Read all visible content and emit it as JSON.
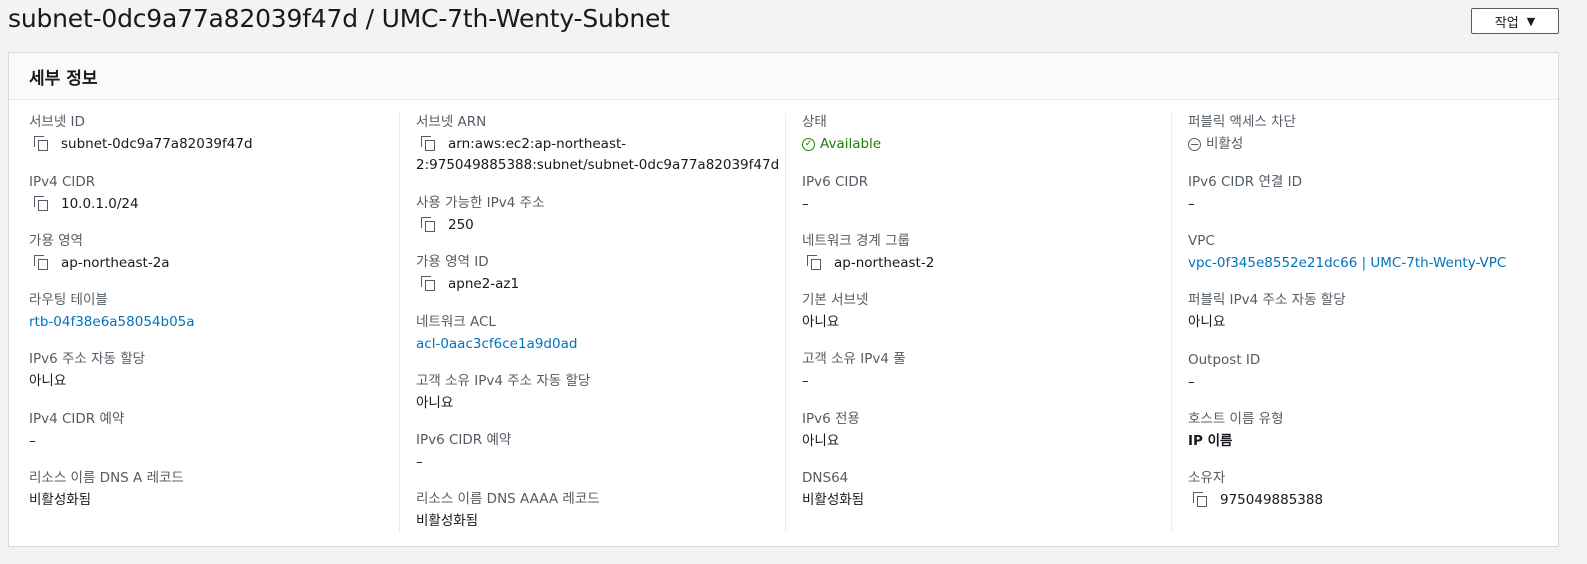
{
  "header": {
    "title": "subnet-0dc9a77a82039f47d / UMC-7th-Wenty-Subnet",
    "actions_label": "작업"
  },
  "panel": {
    "title": "세부 정보"
  },
  "col1": {
    "subnet_id_label": "서브넷 ID",
    "subnet_id_value": "subnet-0dc9a77a82039f47d",
    "ipv4_cidr_label": "IPv4 CIDR",
    "ipv4_cidr_value": "10.0.1.0/24",
    "az_label": "가용 영역",
    "az_value": "ap-northeast-2a",
    "route_table_label": "라우팅 테이블",
    "route_table_value": "rtb-04f38e6a58054b05a",
    "ipv6_auto_label": "IPv6 주소 자동 할당",
    "ipv6_auto_value": "아니요",
    "ipv4_reservation_label": "IPv4 CIDR 예약",
    "ipv4_reservation_value": "–",
    "dns_a_label": "리소스 이름 DNS A 레코드",
    "dns_a_value": "비활성화됨"
  },
  "col2": {
    "arn_label": "서브넷 ARN",
    "arn_value_line1": "arn:aws:ec2:ap-northeast-",
    "arn_value_line2": "2:975049885388:subnet/subnet-0dc9a77a82039f47d",
    "available_ipv4_label": "사용 가능한 IPv4 주소",
    "available_ipv4_value": "250",
    "az_id_label": "가용 영역 ID",
    "az_id_value": "apne2-az1",
    "acl_label": "네트워크 ACL",
    "acl_value": "acl-0aac3cf6ce1a9d0ad",
    "customer_ipv4_auto_label": "고객 소유 IPv4 주소 자동 할당",
    "customer_ipv4_auto_value": "아니요",
    "ipv6_reservation_label": "IPv6 CIDR 예약",
    "ipv6_reservation_value": "–",
    "dns_aaaa_label": "리소스 이름 DNS AAAA 레코드",
    "dns_aaaa_value": "비활성화됨"
  },
  "col3": {
    "state_label": "상태",
    "state_value": "Available",
    "ipv6_cidr_label": "IPv6 CIDR",
    "ipv6_cidr_value": "–",
    "border_group_label": "네트워크 경계 그룹",
    "border_group_value": "ap-northeast-2",
    "default_subnet_label": "기본 서브넷",
    "default_subnet_value": "아니요",
    "customer_pool_label": "고객 소유 IPv4 풀",
    "customer_pool_value": "–",
    "ipv6_only_label": "IPv6 전용",
    "ipv6_only_value": "아니요",
    "dns64_label": "DNS64",
    "dns64_value": "비활성화됨"
  },
  "col4": {
    "public_block_label": "퍼블릭 액세스 차단",
    "public_block_value": "비활성",
    "ipv6_assoc_label": "IPv6 CIDR 연결 ID",
    "ipv6_assoc_value": "–",
    "vpc_label": "VPC",
    "vpc_value": "vpc-0f345e8552e21dc66 | UMC-7th-Wenty-VPC",
    "public_ipv4_auto_label": "퍼블릭 IPv4 주소 자동 할당",
    "public_ipv4_auto_value": "아니요",
    "outpost_label": "Outpost ID",
    "outpost_value": "–",
    "hostname_type_label": "호스트 이름 유형",
    "hostname_type_value": "IP 이름",
    "owner_label": "소유자",
    "owner_value": "975049885388"
  },
  "colors": {
    "link": "#0073bb",
    "success": "#1d8102",
    "label": "#545b64",
    "text": "#16191f"
  }
}
